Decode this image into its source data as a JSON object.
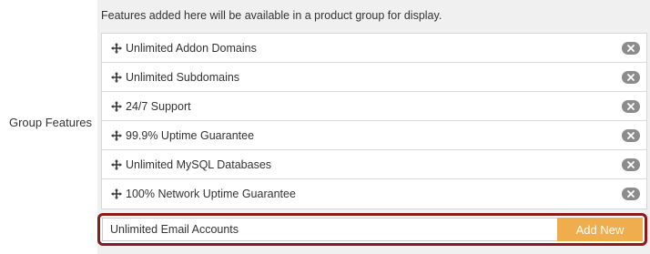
{
  "form": {
    "label": "Group Features",
    "hint": "Features added here will be available in a product group for display.",
    "features": [
      {
        "name": "Unlimited Addon Domains"
      },
      {
        "name": "Unlimited Subdomains"
      },
      {
        "name": "24/7 Support"
      },
      {
        "name": "99.9% Uptime Guarantee"
      },
      {
        "name": "Unlimited MySQL Databases"
      },
      {
        "name": "100% Network Uptime Guarantee"
      }
    ],
    "new_feature_value": "Unlimited Email Accounts",
    "add_button_label": "Add New"
  },
  "icons": {
    "drag": "move-arrows-icon",
    "remove": "times-icon"
  },
  "colors": {
    "add_button": "#f0ad4e",
    "highlight_border": "#8b1a1a",
    "remove_badge": "#8c8c8c",
    "field_background": "#f0f0f0"
  }
}
